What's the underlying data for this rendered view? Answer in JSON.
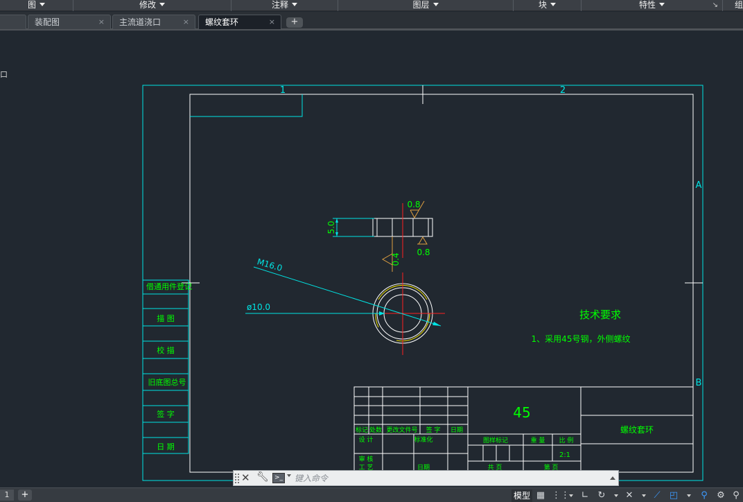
{
  "ribbon": {
    "panels": [
      {
        "id": "draw",
        "label": "图"
      },
      {
        "id": "modify",
        "label": "修改"
      },
      {
        "id": "annotate",
        "label": "注释"
      },
      {
        "id": "layers",
        "label": "图层"
      },
      {
        "id": "block",
        "label": "块"
      },
      {
        "id": "properties",
        "label": "特性"
      },
      {
        "id": "groups",
        "label": "组"
      }
    ]
  },
  "tabs": [
    {
      "label": "装配图",
      "close": "×"
    },
    {
      "label": "主流道浇口",
      "close": "×"
    },
    {
      "label": "螺纹套环",
      "close": "×",
      "active": true
    }
  ],
  "tab_add": "+",
  "viewport_label": "口",
  "drawing": {
    "zone_cols": [
      "1",
      "2"
    ],
    "zone_rows": [
      "A",
      "B"
    ],
    "dims": {
      "thread": "M16.0",
      "diameter": "ø10.0",
      "thickness": "5.0",
      "rough_top": "0.8",
      "rough_bottom": "0.8",
      "rough_left": "0.4"
    },
    "tech_title": "技术要求",
    "tech_note": "1、采用45号钢，外侧螺纹",
    "left_stamp": [
      "借通用件登记",
      "描 图",
      "校 描",
      "旧底图总号",
      "签 字",
      "日 期"
    ],
    "title_block": {
      "material": "45",
      "part_name": "螺纹套环",
      "rev_headers": [
        "标记",
        "处数",
        "更改文件号",
        "签 字",
        "日期"
      ],
      "sign_rows": [
        "设 计",
        "标准化",
        "审 核",
        "工 艺",
        "日期"
      ],
      "stage_headers": [
        "图样标记",
        "重 量",
        "比 例"
      ],
      "scale": "2:1",
      "sheet_labels": [
        "共 页",
        "第 页"
      ]
    }
  },
  "command_line": {
    "placeholder": "键入命令"
  },
  "statusbar": {
    "layout_tab": "1",
    "layout_add": "+",
    "model": "模型"
  },
  "colors": {
    "cyan": "#00e5e5",
    "green": "#00ff00",
    "white": "#ffffff",
    "red": "#ff2020",
    "yellow": "#f0e000",
    "orange": "#e0a040",
    "canvas": "#212830"
  }
}
